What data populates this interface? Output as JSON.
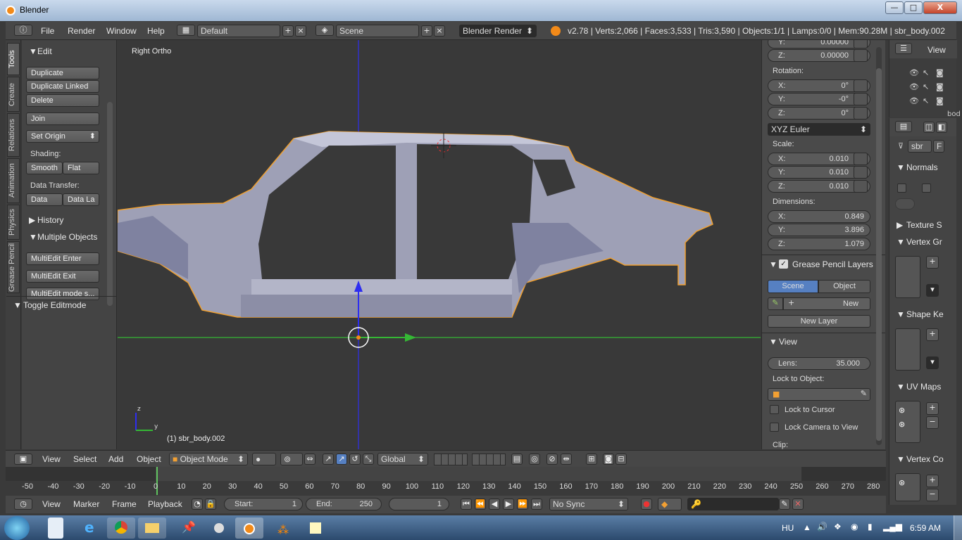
{
  "window": {
    "title": "Blender",
    "controls": {
      "minimize": "—",
      "maximize": "□",
      "close": "X"
    }
  },
  "info_header": {
    "menus": [
      "File",
      "Render",
      "Window",
      "Help"
    ],
    "layout": "Default",
    "scene": "Scene",
    "engine": "Blender Render",
    "stats": "v2.78 | Verts:2,066 | Faces:3,533 | Tris:3,590 | Objects:1/1 | Lamps:0/0 | Mem:90.28M | sbr_body.002"
  },
  "tool_tabs": [
    "Tools",
    "Create",
    "Relations",
    "Animation",
    "Physics",
    "Grease Pencil"
  ],
  "tool_shelf": {
    "edit_title": "Edit",
    "duplicate": "Duplicate",
    "duplicate_linked": "Duplicate Linked",
    "delete": "Delete",
    "join": "Join",
    "set_origin": "Set Origin",
    "shading_label": "Shading:",
    "smooth": "Smooth",
    "flat": "Flat",
    "data_transfer_label": "Data Transfer:",
    "data": "Data",
    "data_layout": "Data La",
    "history": "History",
    "multiple_objects": "Multiple Objects",
    "multiedit_enter": "MultiEdit Enter",
    "multiedit_exit": "MultiEdit Exit",
    "multiedit_mode": "MultiEdit mode s...",
    "toggle_editmode": "Toggle Editmode"
  },
  "viewport": {
    "view_name": "Right Ortho",
    "object_label": "(1) sbr_body.002",
    "axis_z": "z",
    "axis_y": "y"
  },
  "npanel": {
    "loc_y": {
      "k": "Y:",
      "v": "0.00000"
    },
    "loc_z": {
      "k": "Z:",
      "v": "0.00000"
    },
    "rotation_label": "Rotation:",
    "rot": [
      {
        "k": "X:",
        "v": "0°"
      },
      {
        "k": "Y:",
        "v": "-0°"
      },
      {
        "k": "Z:",
        "v": "0°"
      }
    ],
    "rotation_mode": "XYZ Euler",
    "scale_label": "Scale:",
    "scale": [
      {
        "k": "X:",
        "v": "0.010"
      },
      {
        "k": "Y:",
        "v": "0.010"
      },
      {
        "k": "Z:",
        "v": "0.010"
      }
    ],
    "dimensions_label": "Dimensions:",
    "dims": [
      {
        "k": "X:",
        "v": "0.849"
      },
      {
        "k": "Y:",
        "v": "3.896"
      },
      {
        "k": "Z:",
        "v": "1.079"
      }
    ],
    "grease_pencil_title": "Grease Pencil Layers",
    "gp_scene": "Scene",
    "gp_object": "Object",
    "gp_new": "New",
    "gp_new_layer": "New Layer",
    "view_title": "View",
    "lens_k": "Lens:",
    "lens_v": "35.000",
    "lock_to_object": "Lock to Object:",
    "lock_to_cursor": "Lock to Cursor",
    "lock_camera_to_view": "Lock Camera to View",
    "clip": "Clip:"
  },
  "outliner": {
    "view": "View",
    "frag": "bod"
  },
  "properties": {
    "obj_name": "sbr",
    "obj_f": "F",
    "normals": "Normals",
    "texture_space": "Texture S",
    "vertex_groups": "Vertex Gr",
    "shape_keys": "Shape Ke",
    "uv_maps": "UV Maps",
    "vertex_colors": "Vertex Co"
  },
  "view3d_header": {
    "view": "View",
    "select": "Select",
    "add": "Add",
    "object": "Object",
    "mode": "Object Mode",
    "orientation": "Global"
  },
  "timeline": {
    "ticks": [
      "-50",
      "-40",
      "-30",
      "-20",
      "-10",
      "0",
      "10",
      "20",
      "30",
      "40",
      "50",
      "60",
      "70",
      "80",
      "90",
      "100",
      "110",
      "120",
      "130",
      "140",
      "150",
      "160",
      "170",
      "180",
      "190",
      "200",
      "210",
      "220",
      "230",
      "240",
      "250",
      "260",
      "270",
      "280"
    ],
    "view": "View",
    "marker": "Marker",
    "frame": "Frame",
    "playback": "Playback",
    "start_k": "Start:",
    "start_v": "1",
    "end_k": "End:",
    "end_v": "250",
    "current": "1",
    "sync": "No Sync"
  },
  "taskbar": {
    "lang": "HU",
    "time": "6:59 AM"
  }
}
